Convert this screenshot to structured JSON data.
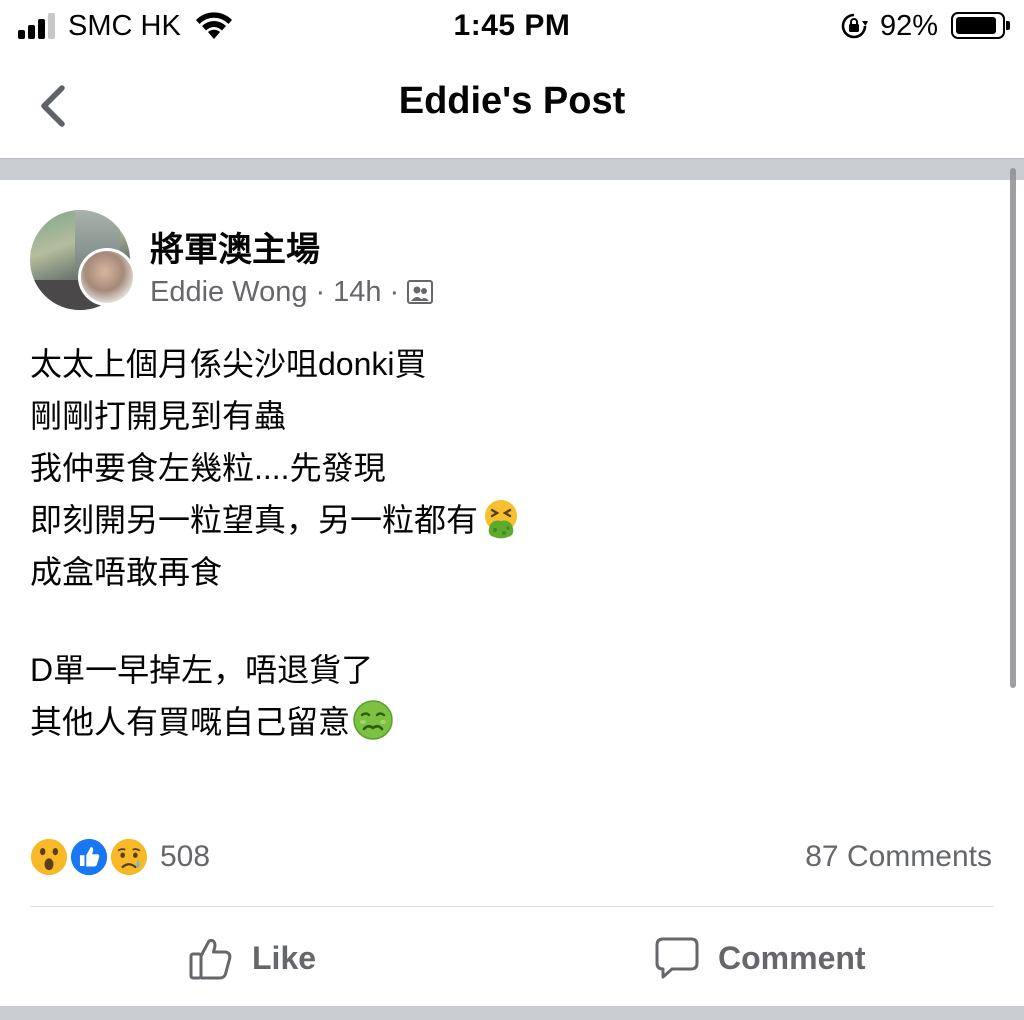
{
  "status_bar": {
    "carrier": "SMC HK",
    "time": "1:45 PM",
    "battery_percent": "92%",
    "battery_level": 0.92,
    "signal_bars_filled": 3,
    "signal_bars_total": 4
  },
  "header": {
    "title": "Eddie's Post",
    "back_icon": "chevron-left-icon"
  },
  "post": {
    "group_name": "將軍澳主場",
    "author": "Eddie Wong",
    "time_ago": "14h",
    "separator": "·",
    "visibility_icon": "group-members-icon",
    "lines": [
      "太太上個月係尖沙咀donki買",
      "剛剛打開見到有蟲",
      "我仲要食左幾粒....先發現",
      "即刻開另一粒望真，另一粒都有",
      "成盒唔敢再食",
      "D單一早掉左，唔退貨了",
      "其他人有買嘅自己留意"
    ],
    "emoji_line4": "vomiting-face-emoji",
    "emoji_line7": "nauseated-face-emoji"
  },
  "engagement": {
    "reactions": [
      "wow",
      "like",
      "sad"
    ],
    "reaction_count": "508",
    "comments": "87 Comments"
  },
  "actions": {
    "like_label": "Like",
    "comment_label": "Comment"
  },
  "colors": {
    "text": "#050505",
    "secondary_text": "#65676b",
    "like_blue": "#1877f2",
    "reaction_yellow": "#f7b928",
    "separator_gray": "#c9ccd1"
  }
}
